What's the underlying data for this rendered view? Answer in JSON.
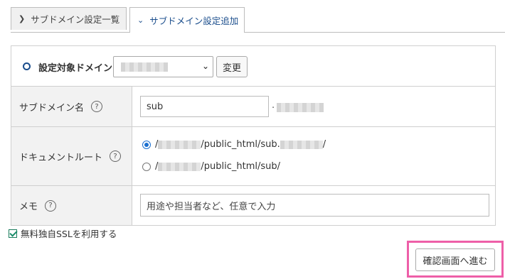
{
  "tabs": [
    {
      "label": "サブドメイン設定一覧",
      "active": false
    },
    {
      "label": "サブドメイン設定追加",
      "active": true
    }
  ],
  "domain_row": {
    "label": "設定対象ドメイン",
    "change_button": "変更"
  },
  "subdomain_row": {
    "label": "サブドメイン名",
    "help": "?",
    "value": "sub",
    "separator": "."
  },
  "docroot_row": {
    "label": "ドキュメントルート",
    "help": "?",
    "options": [
      {
        "prefix": "/",
        "middle": "/public_html/sub.",
        "suffix": "/",
        "selected": true
      },
      {
        "prefix": "/",
        "middle": "/public_html/sub/",
        "suffix": "",
        "selected": false
      }
    ]
  },
  "memo_row": {
    "label": "メモ",
    "help": "?",
    "placeholder": "用途や担当者など、任意で入力"
  },
  "ssl_checkbox": {
    "label": "無料独自SSLを利用する",
    "checked": true
  },
  "next_button": {
    "label": "確認画面へ進む"
  },
  "colors": {
    "accent": "#1a4d8c",
    "highlight": "#ee5fa8",
    "label_bg": "#f2f2f2"
  }
}
